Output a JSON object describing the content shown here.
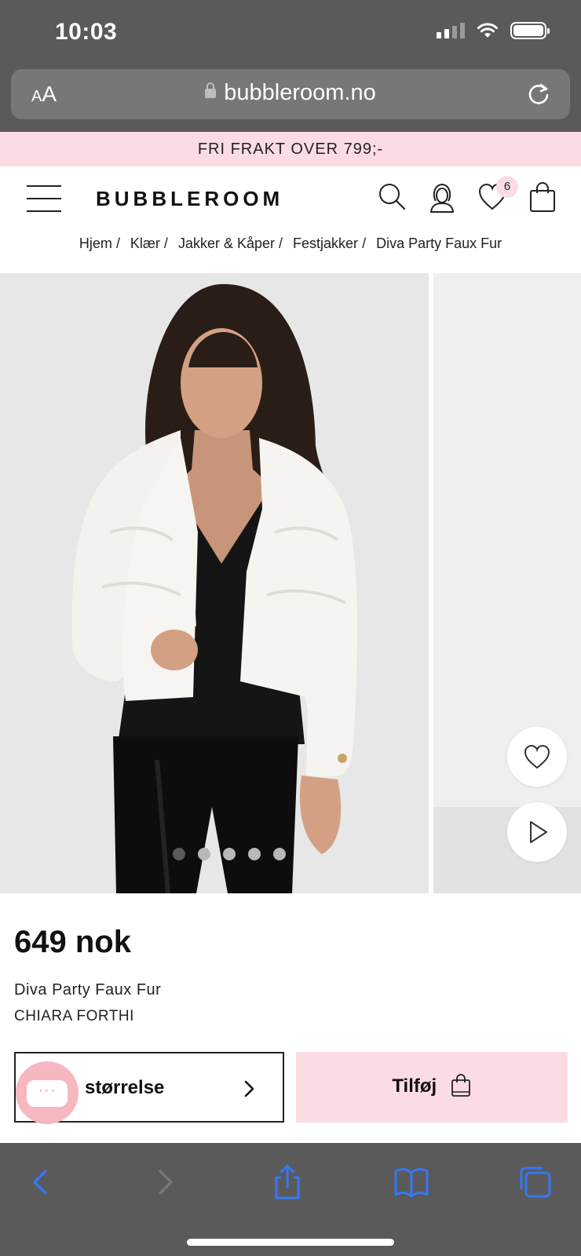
{
  "status_bar": {
    "time": "10:03"
  },
  "browser": {
    "aa_small": "A",
    "aa_large": "A",
    "url": "bubbleroom.no"
  },
  "promo": {
    "text": "FRI FRAKT OVER 799;-"
  },
  "header": {
    "logo": "BUBBLEROOM",
    "wishlist_count": "6"
  },
  "breadcrumb": [
    {
      "label": "Hjem"
    },
    {
      "label": "Klær"
    },
    {
      "label": "Jakker & Kåper"
    },
    {
      "label": "Festjakker"
    },
    {
      "label": "Diva Party Faux Fur"
    }
  ],
  "breadcrumb_separator": "/",
  "gallery": {
    "image_count": 5,
    "active_index": 0
  },
  "product": {
    "price": "649 nok",
    "name": "Diva Party Faux Fur",
    "brand": "CHIARA FORTHI"
  },
  "actions": {
    "size_label": "størrelse",
    "add_label": "Tilføj"
  },
  "chat": {
    "dots": "···"
  },
  "colors": {
    "accent_pink": "#fcdce3",
    "chat_pink": "#f7b7c0",
    "ios_blue": "#3478f6",
    "chrome_gray": "#5a5a5a"
  }
}
